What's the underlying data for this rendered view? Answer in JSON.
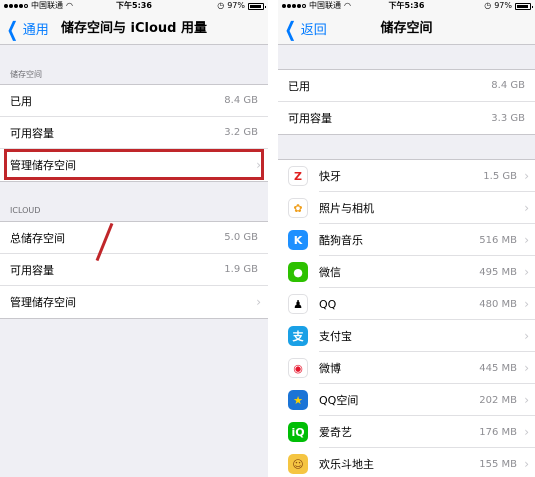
{
  "left": {
    "status": {
      "carrier": "中国联通",
      "time": "下午5:36",
      "battery": "97%"
    },
    "nav": {
      "back": "通用",
      "title": "储存空间与 iCloud 用量"
    },
    "storage": {
      "header": "储存空间",
      "used_label": "已用",
      "used_value": "8.4 GB",
      "available_label": "可用容量",
      "available_value": "3.2 GB",
      "manage_label": "管理储存空间"
    },
    "icloud": {
      "header": "ICLOUD",
      "total_label": "总储存空间",
      "total_value": "5.0 GB",
      "available_label": "可用容量",
      "available_value": "1.9 GB",
      "manage_label": "管理储存空间"
    },
    "highlight_color": "#c0262a"
  },
  "right": {
    "status": {
      "carrier": "中国联通",
      "time": "下午5:36",
      "battery": "97%"
    },
    "nav": {
      "back": "返回",
      "title": "储存空间"
    },
    "summary": {
      "used_label": "已用",
      "used_value": "8.4 GB",
      "available_label": "可用容量",
      "available_value": "3.3 GB"
    },
    "apps": [
      {
        "name": "快牙",
        "size": "1.5 GB",
        "icon": "kuaiya-icon",
        "color": "#ffffff",
        "glyph": "Z",
        "glyph_color": "#e02020"
      },
      {
        "name": "照片与相机",
        "size": "",
        "icon": "photos-icon",
        "color": "#ffffff",
        "glyph": "✿",
        "glyph_color": "#f0a020"
      },
      {
        "name": "酷狗音乐",
        "size": "516 MB",
        "icon": "kugou-icon",
        "color": "#1e90ff",
        "glyph": "K",
        "glyph_color": "#ffffff"
      },
      {
        "name": "微信",
        "size": "495 MB",
        "icon": "wechat-icon",
        "color": "#2dc100",
        "glyph": "●",
        "glyph_color": "#ffffff"
      },
      {
        "name": "QQ",
        "size": "480 MB",
        "icon": "qq-icon",
        "color": "#ffffff",
        "glyph": "♟",
        "glyph_color": "#000000"
      },
      {
        "name": "支付宝",
        "size": "",
        "icon": "alipay-icon",
        "color": "#1aa0e6",
        "glyph": "支",
        "glyph_color": "#ffffff"
      },
      {
        "name": "微博",
        "size": "445 MB",
        "icon": "weibo-icon",
        "color": "#ffffff",
        "glyph": "◉",
        "glyph_color": "#e6162d"
      },
      {
        "name": "QQ空间",
        "size": "202 MB",
        "icon": "qzone-icon",
        "color": "#1b74d6",
        "glyph": "★",
        "glyph_color": "#ffd200"
      },
      {
        "name": "爱奇艺",
        "size": "176 MB",
        "icon": "iqiyi-icon",
        "color": "#00be06",
        "glyph": "iQ",
        "glyph_color": "#ffffff"
      },
      {
        "name": "欢乐斗地主",
        "size": "155 MB",
        "icon": "doudizhu-icon",
        "color": "#f5c542",
        "glyph": "☺",
        "glyph_color": "#8a4b12"
      }
    ]
  }
}
